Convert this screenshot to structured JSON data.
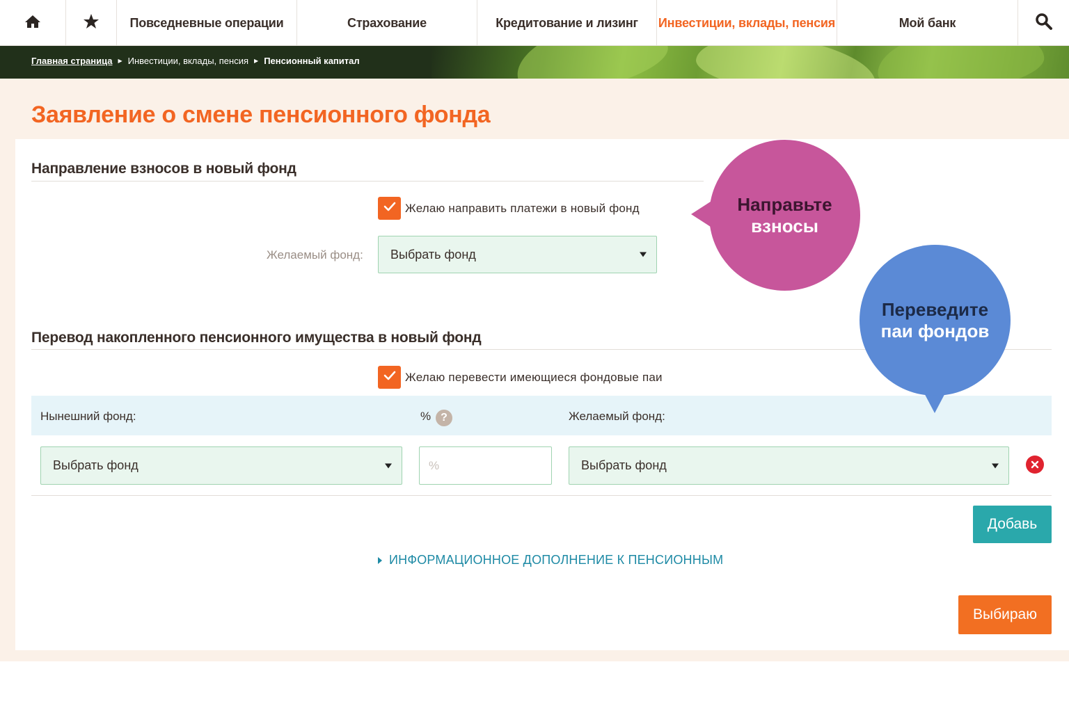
{
  "nav": {
    "home_icon": "home-icon",
    "star_icon": "star-icon",
    "items": [
      {
        "label": "Повседневные операции"
      },
      {
        "label": "Страхование"
      },
      {
        "label": "Кредитование и лизинг"
      },
      {
        "label": "Инвестиции, вклады, пенсия",
        "active": true
      },
      {
        "label": "Мой банк"
      }
    ],
    "search_icon": "search-icon",
    "active_color": "#f26522"
  },
  "breadcrumb": {
    "home": "Главная страница",
    "section": "Инвестиции, вклады, пенсия",
    "current": "Пенсионный капитал"
  },
  "page_title": "Заявление о смене пенсионного фонда",
  "contributions": {
    "title": "Направление взносов в новый фонд",
    "checkbox_label": "Желаю направить платежи в новый фонд",
    "checkbox_checked": true,
    "fund_label": "Желаемый фонд:",
    "fund_select_value": "Выбрать фонд"
  },
  "transfer": {
    "title": "Перевод накопленного пенсионного имущества в новый фонд",
    "checkbox_label": "Желаю перевести имеющиеся фондовые паи",
    "checkbox_checked": true,
    "columns": {
      "current_fund": "Нынешний фонд:",
      "percent": "%",
      "desired_fund": "Желаемый фонд:"
    },
    "help_glyph": "?",
    "row": {
      "current_fund_value": "Выбрать фонд",
      "percent_placeholder": "%",
      "desired_fund_value": "Выбрать фонд"
    },
    "add_button": "Добавь"
  },
  "info_link": "ИНФОРМАЦИОННОЕ ДОПОЛНЕНИЕ К ПЕНСИОННЫМ",
  "submit_button": "Выбираю",
  "callouts": {
    "pink": {
      "line1": "Направьте",
      "line2": "взносы",
      "color": "#c7569b"
    },
    "blue": {
      "line1": "Переведите",
      "line2": "паи фондов",
      "color": "#5b8ad6"
    }
  },
  "colors": {
    "brand_orange": "#f26522",
    "teal_button": "#2aa8ab",
    "select_bg": "#e9f6ee"
  }
}
